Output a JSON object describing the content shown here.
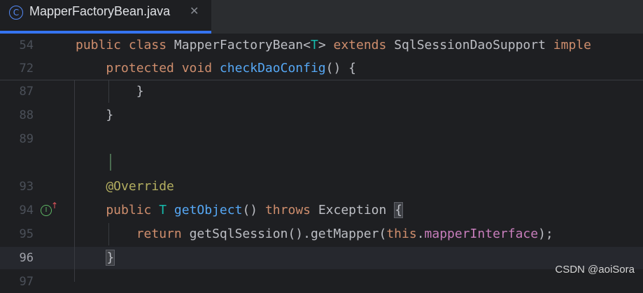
{
  "tab": {
    "icon": "class-icon",
    "icon_glyph": "C",
    "title": "MapperFactoryBean.java",
    "close_glyph": "✕"
  },
  "sticky_lines": [
    {
      "number": "54",
      "tokens": [
        {
          "t": "public class ",
          "c": "kw"
        },
        {
          "t": "MapperFactoryBean<",
          "c": ""
        },
        {
          "t": "T",
          "c": "typ"
        },
        {
          "t": "> ",
          "c": ""
        },
        {
          "t": "extends ",
          "c": "kw"
        },
        {
          "t": "SqlSessionDaoSupport ",
          "c": ""
        },
        {
          "t": "imple",
          "c": "kw"
        }
      ]
    },
    {
      "number": "72",
      "tokens": [
        {
          "t": "    protected void ",
          "c": "kw"
        },
        {
          "t": "checkDaoConfig",
          "c": "fn"
        },
        {
          "t": "() {",
          "c": ""
        }
      ]
    }
  ],
  "lines": [
    {
      "number": "87",
      "text": "        }"
    },
    {
      "number": "88",
      "text": "    }"
    },
    {
      "number": "89",
      "text": ""
    },
    {
      "number": "",
      "text": ""
    },
    {
      "number": "93",
      "tokens": [
        {
          "t": "    @Override",
          "c": "ann"
        }
      ]
    },
    {
      "number": "94",
      "tokens": [
        {
          "t": "    public ",
          "c": "kw"
        },
        {
          "t": "T ",
          "c": "typ"
        },
        {
          "t": "getObject",
          "c": "fn"
        },
        {
          "t": "() ",
          "c": ""
        },
        {
          "t": "throws ",
          "c": "kw"
        },
        {
          "t": "Exception ",
          "c": ""
        },
        {
          "t": "{",
          "c": "brace"
        }
      ]
    },
    {
      "number": "95",
      "tokens": [
        {
          "t": "        return ",
          "c": "kw"
        },
        {
          "t": "getSqlSession().getMapper(",
          "c": ""
        },
        {
          "t": "this",
          "c": "kw"
        },
        {
          "t": ".",
          "c": ""
        },
        {
          "t": "mapperInterface",
          "c": "fld"
        },
        {
          "t": ");",
          "c": ""
        }
      ]
    },
    {
      "number": "96",
      "tokens": [
        {
          "t": "    ",
          "c": ""
        },
        {
          "t": "}",
          "c": "brace"
        }
      ],
      "current": true
    },
    {
      "number": "97",
      "text": ""
    }
  ],
  "gutter": {
    "implements_icon": "implementation-icon",
    "implements_glyph": "I",
    "override_arrow_icon": "override-up-arrow-icon",
    "override_arrow_glyph": "↑"
  },
  "watermark": "CSDN @aoiSora",
  "colors": {
    "keyword": "#cf8e6d",
    "function": "#56a8f5",
    "field": "#c77dbb",
    "type_param": "#16baac",
    "annotation": "#b3ae60",
    "text": "#bcbec4",
    "accent": "#3574f0"
  }
}
